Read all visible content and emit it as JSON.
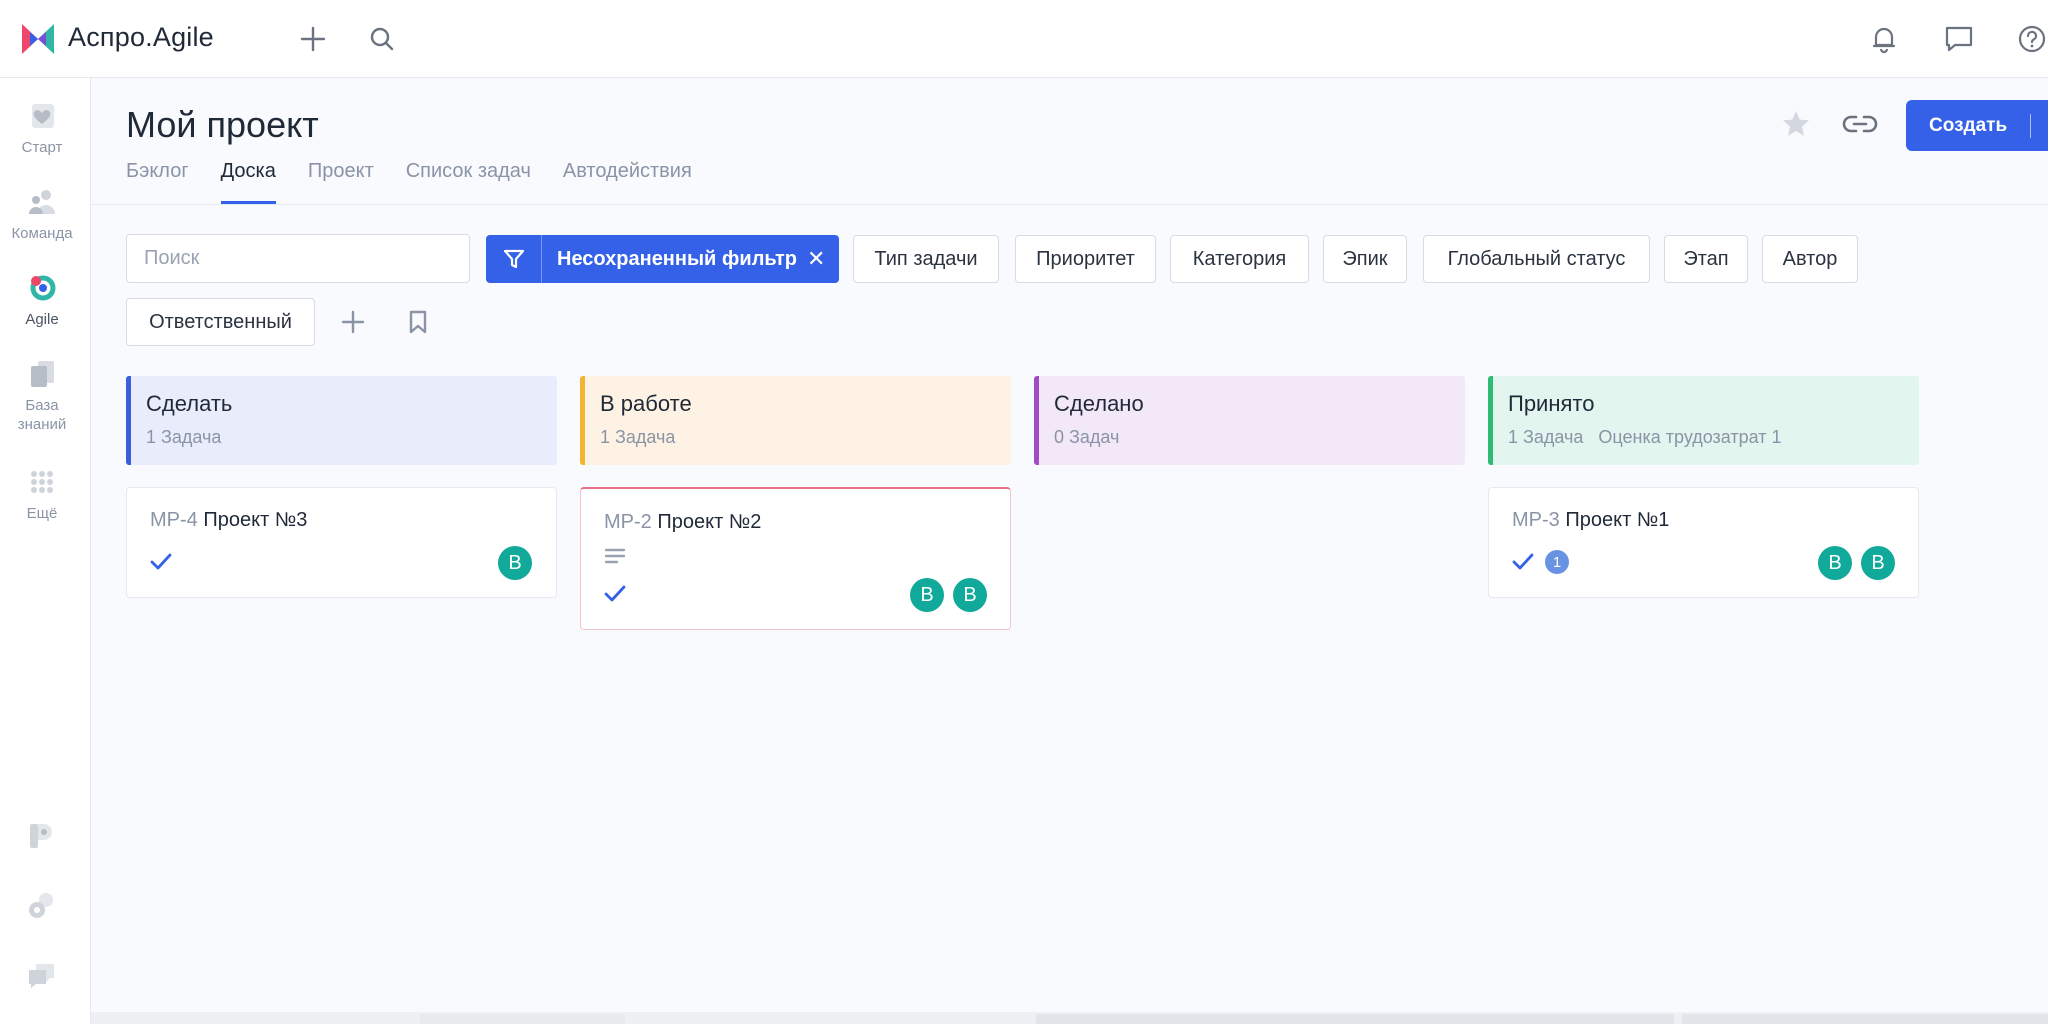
{
  "app": {
    "title": "Аспро.Agile"
  },
  "sidebar": {
    "items": [
      {
        "label": "Старт",
        "icon": "heart-icon"
      },
      {
        "label": "Команда",
        "icon": "team-icon"
      },
      {
        "label": "Agile",
        "icon": "agile-icon"
      },
      {
        "label": "База знаний",
        "icon": "knowledge-base-icon"
      },
      {
        "label": "Ещё",
        "icon": "more-grid-icon"
      }
    ]
  },
  "header": {
    "title": "Мой проект",
    "tabs": [
      "Бэклог",
      "Доска",
      "Проект",
      "Список задач",
      "Автодействия"
    ],
    "active_tab": "Доска",
    "create_label": "Создать"
  },
  "filters": {
    "search_placeholder": "Поиск",
    "active_filter_label": "Несохраненный фильтр",
    "chips": [
      "Тип задачи",
      "Приоритет",
      "Категория",
      "Эпик",
      "Глобальный статус",
      "Этап",
      "Автор",
      "Ответственный"
    ]
  },
  "board": {
    "columns": [
      {
        "title": "Сделать",
        "subtitle": "1 Задача",
        "accent": "#3a5fdb",
        "bg": "#e8ecfb"
      },
      {
        "title": "В работе",
        "subtitle": "1 Задача",
        "accent": "#f2b531",
        "bg": "#fdf2e3"
      },
      {
        "title": "Сделано",
        "subtitle": "0 Задач",
        "accent": "#a04cc4",
        "bg": "#f3e8f7"
      },
      {
        "title": "Принято",
        "subtitle": "1 Задача",
        "subtitle_extra": "Оценка трудозатрат 1",
        "accent": "#2fbb73",
        "bg": "#e3f5ef"
      }
    ],
    "cards": [
      {
        "key": "MP-4",
        "title": "Проект №3",
        "avatars": [
          "В"
        ]
      },
      {
        "key": "MP-2",
        "title": "Проект №2",
        "avatars": [
          "В",
          "В"
        ]
      },
      {
        "key": "MP-3",
        "title": "Проект №1",
        "badge": "1",
        "avatars": [
          "В",
          "В"
        ]
      }
    ]
  },
  "colors": {
    "accent": "#3461e8",
    "avatar": "#10a99a"
  }
}
